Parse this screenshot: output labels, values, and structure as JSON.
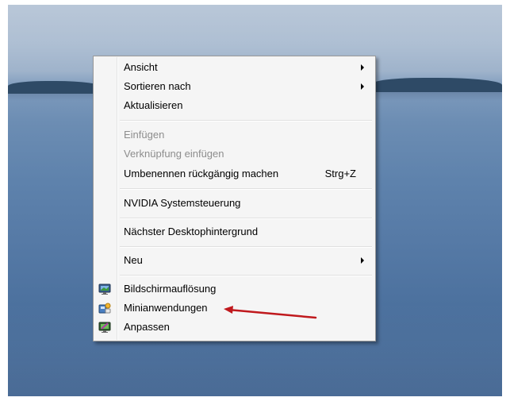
{
  "context_menu": {
    "items": [
      {
        "label": "Ansicht",
        "submenu": true
      },
      {
        "label": "Sortieren nach",
        "submenu": true
      },
      {
        "label": "Aktualisieren"
      },
      {
        "label": "Einfügen",
        "disabled": true
      },
      {
        "label": "Verknüpfung einfügen",
        "disabled": true
      },
      {
        "label": "Umbenennen rückgängig machen",
        "shortcut": "Strg+Z"
      },
      {
        "label": "NVIDIA Systemsteuerung"
      },
      {
        "label": "Nächster Desktophintergrund"
      },
      {
        "label": "Neu",
        "submenu": true
      },
      {
        "label": "Bildschirmauflösung",
        "icon": "screen-resolution-icon"
      },
      {
        "label": "Minianwendungen",
        "icon": "gadgets-icon"
      },
      {
        "label": "Anpassen",
        "icon": "personalize-icon"
      }
    ]
  },
  "colors": {
    "annotation_arrow": "#c0191d",
    "menu_background": "#f5f5f5"
  }
}
